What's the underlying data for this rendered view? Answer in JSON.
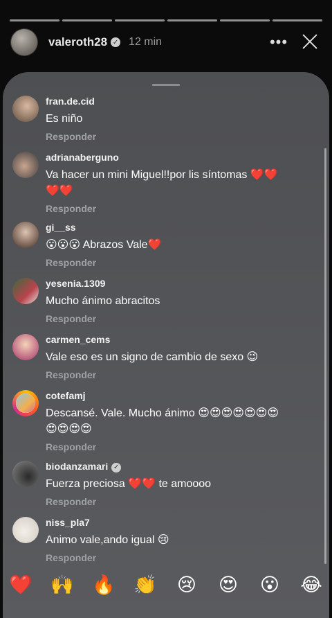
{
  "story": {
    "username": "valeroth28",
    "time": "12 min",
    "more_symbol": "•••",
    "verified_symbol": "✓"
  },
  "comments": [
    {
      "user": "fran.de.cid",
      "text": "Es niño",
      "reply": "Responder"
    },
    {
      "user": "adrianaberguno",
      "text": "Va hacer un mini Miguel!!por lis síntomas ❤️❤️❤️❤️",
      "reply": "Responder"
    },
    {
      "user": "gi__ss",
      "text": "😮😮😮 Abrazos Vale❤️",
      "reply": "Responder"
    },
    {
      "user": "yesenia.1309",
      "text": "Mucho ánimo abracitos",
      "reply": "Responder"
    },
    {
      "user": "carmen_cems",
      "text": "Vale eso es un signo de cambio de sexo 😉",
      "reply": "Responder"
    },
    {
      "user": "cotefamj",
      "text": "Descansé.  Vale. Mucho ánimo 😍😍😍😍😍😍😍😍😍😍😍",
      "reply": "Responder"
    },
    {
      "user": "biodanzamari",
      "text": "Fuerza preciosa ❤️❤️ te amoooo",
      "reply": "Responder",
      "verified": true
    },
    {
      "user": "niss_pla7",
      "text": "Animo vale,ando igual 😢",
      "reply": "Responder"
    }
  ],
  "reactions": [
    "❤️",
    "🙌",
    "🔥",
    "👏",
    "😢",
    "😍",
    "😮",
    "😂"
  ]
}
